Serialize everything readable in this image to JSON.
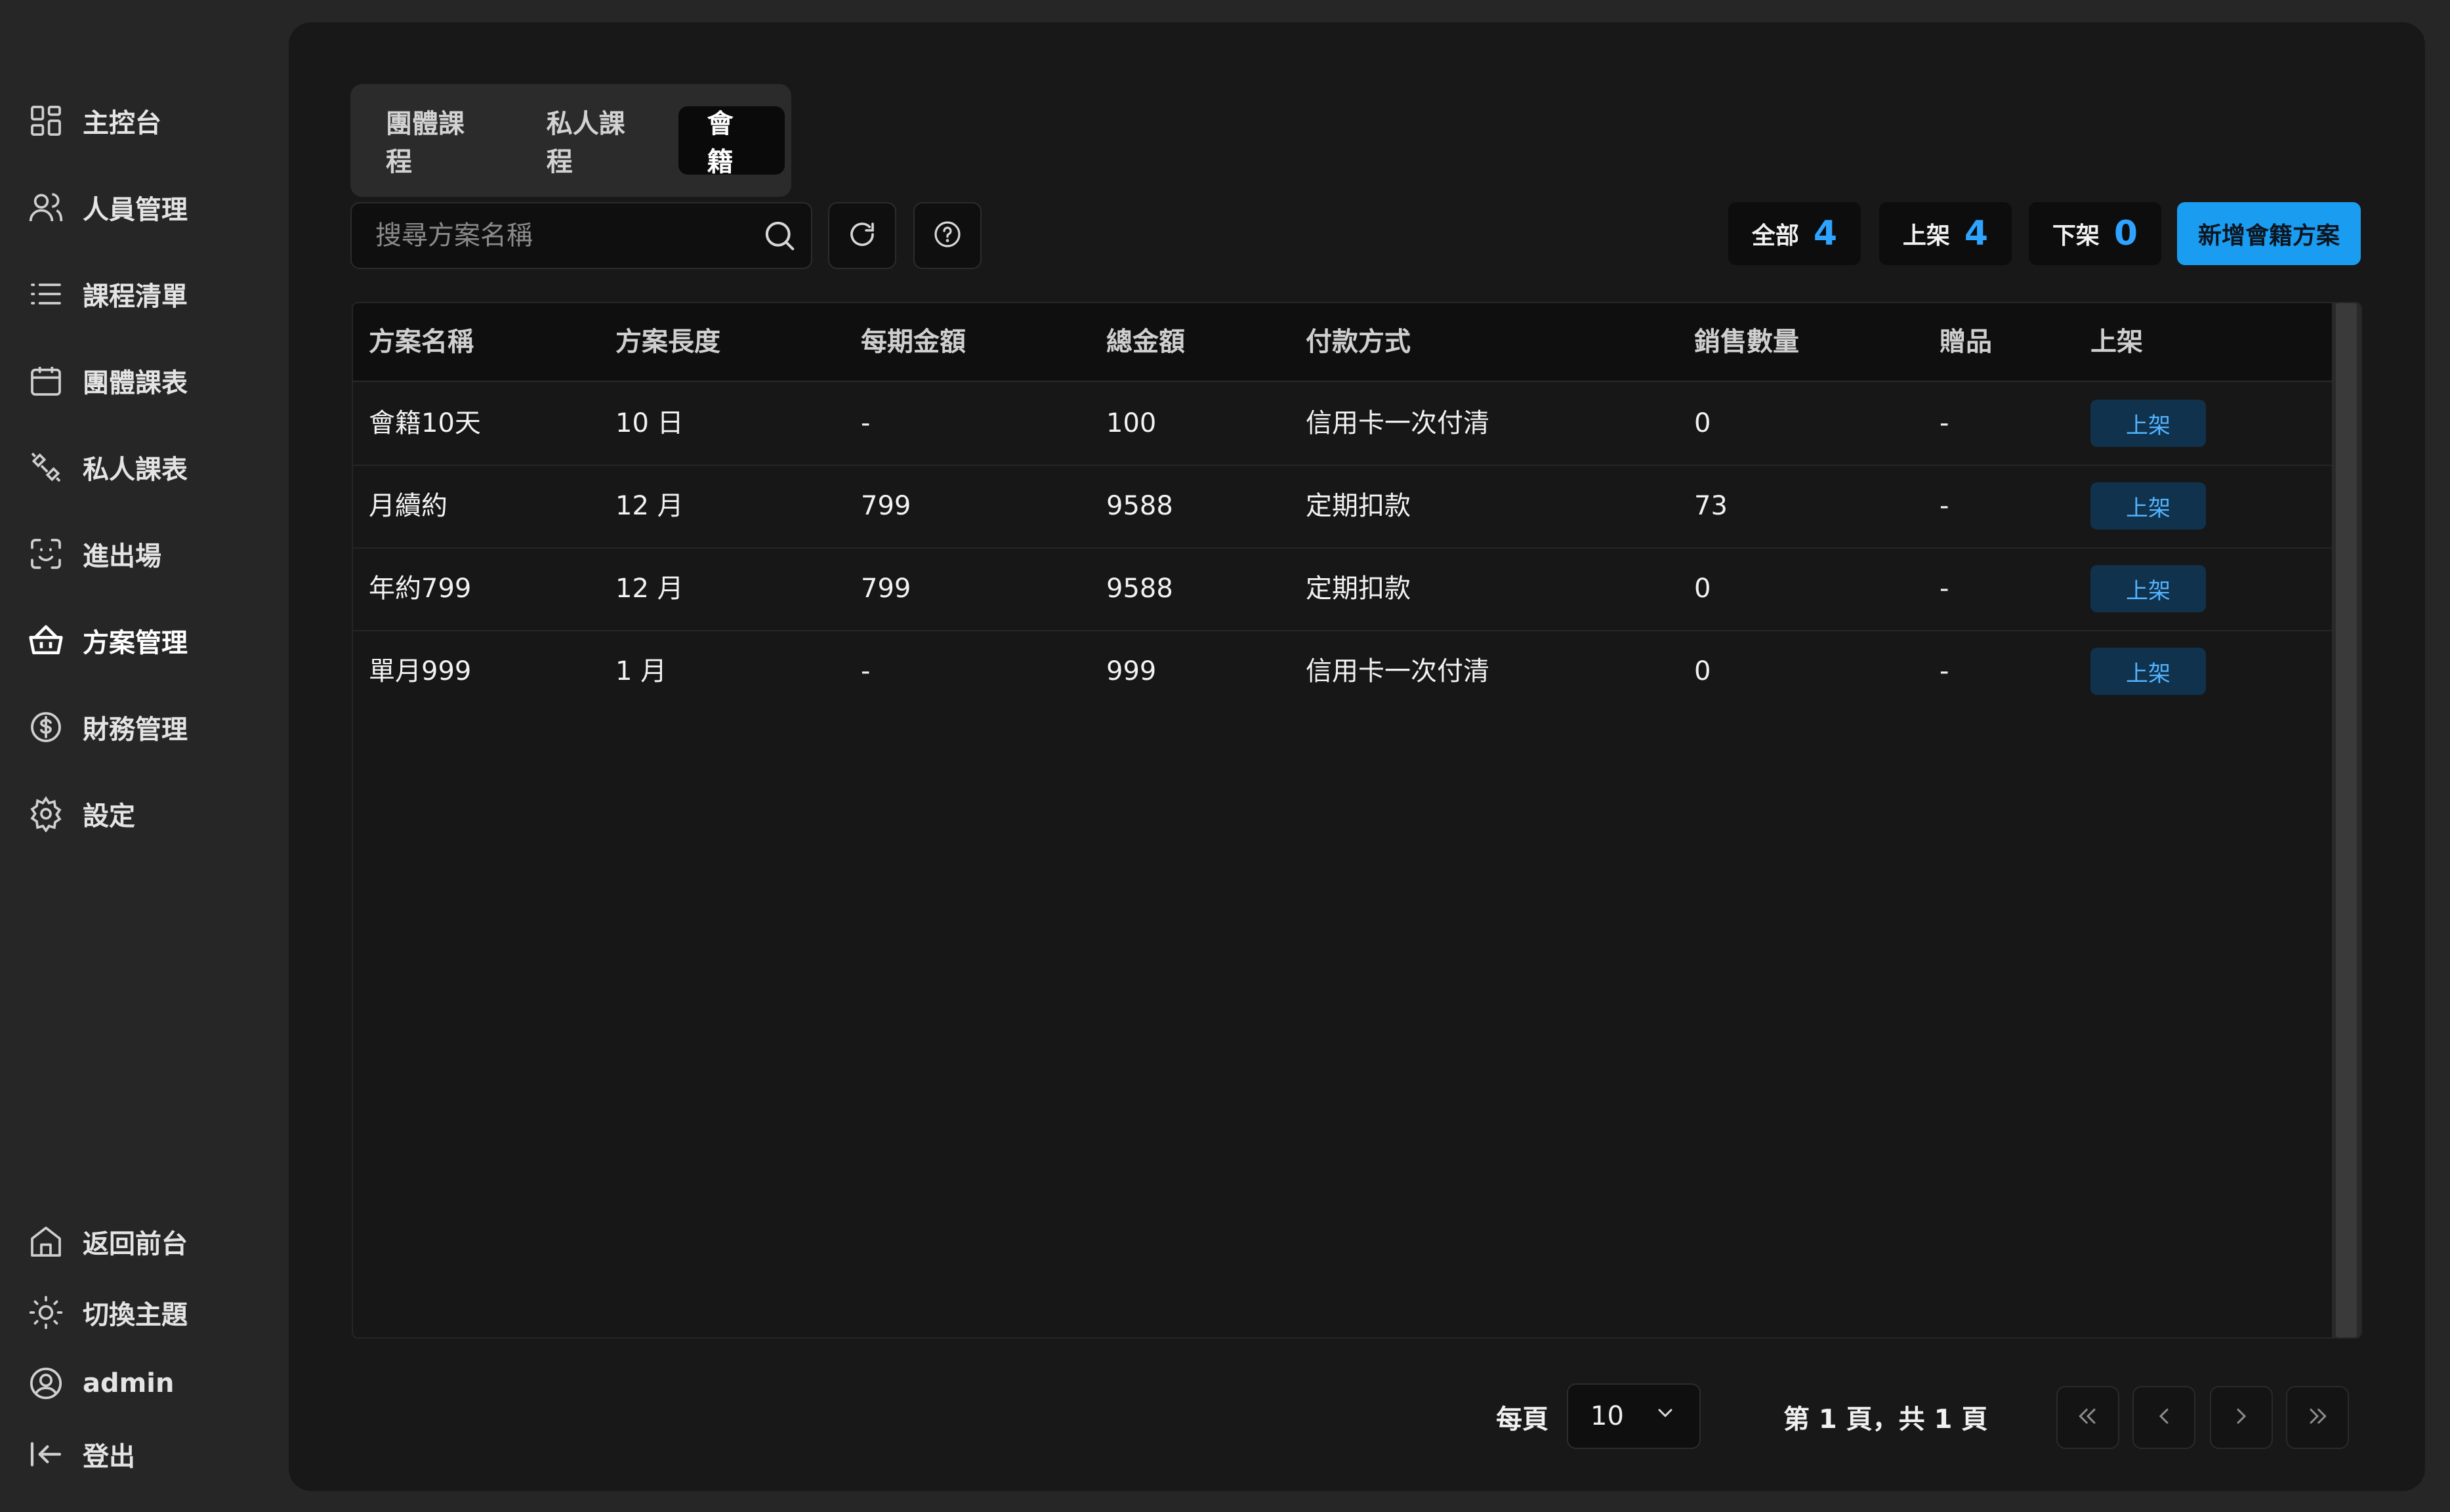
{
  "sidebar": {
    "items": [
      {
        "label": "主控台",
        "icon": "dashboard-icon"
      },
      {
        "label": "人員管理",
        "icon": "users-icon"
      },
      {
        "label": "課程清單",
        "icon": "list-icon"
      },
      {
        "label": "團體課表",
        "icon": "calendar-icon"
      },
      {
        "label": "私人課表",
        "icon": "dumbbell-icon"
      },
      {
        "label": "進出場",
        "icon": "scan-face-icon"
      },
      {
        "label": "方案管理",
        "icon": "basket-icon",
        "active": true
      },
      {
        "label": "財務管理",
        "icon": "dollar-circle-icon"
      },
      {
        "label": "設定",
        "icon": "gear-icon"
      }
    ],
    "bottom": [
      {
        "label": "返回前台",
        "icon": "home-icon"
      },
      {
        "label": "切換主題",
        "icon": "sun-icon"
      },
      {
        "label": "admin",
        "icon": "user-circle-icon"
      },
      {
        "label": "登出",
        "icon": "logout-icon"
      }
    ]
  },
  "tabs": [
    {
      "label": "團體課程"
    },
    {
      "label": "私人課程"
    },
    {
      "label": "會籍",
      "active": true
    }
  ],
  "search": {
    "placeholder": "搜尋方案名稱",
    "value": ""
  },
  "stats": [
    {
      "label": "全部",
      "count": "4"
    },
    {
      "label": "上架",
      "count": "4"
    },
    {
      "label": "下架",
      "count": "0"
    }
  ],
  "add_button": "新增會籍方案",
  "table": {
    "columns": [
      "方案名稱",
      "方案長度",
      "每期金額",
      "總金額",
      "付款方式",
      "銷售數量",
      "贈品",
      "上架"
    ],
    "rows": [
      {
        "name": "會籍10天",
        "length": "10 日",
        "per_period": "-",
        "total": "100",
        "payment": "信用卡一次付清",
        "sales": "0",
        "gift": "-",
        "status": "上架"
      },
      {
        "name": "月續約",
        "length": "12 月",
        "per_period": "799",
        "total": "9588",
        "payment": "定期扣款",
        "sales": "73",
        "gift": "-",
        "status": "上架"
      },
      {
        "name": "年約799",
        "length": "12 月",
        "per_period": "799",
        "total": "9588",
        "payment": "定期扣款",
        "sales": "0",
        "gift": "-",
        "status": "上架"
      },
      {
        "name": "單月999",
        "length": "1 月",
        "per_period": "-",
        "total": "999",
        "payment": "信用卡一次付清",
        "sales": "0",
        "gift": "-",
        "status": "上架"
      }
    ]
  },
  "pagination": {
    "per_page_label": "每頁",
    "per_page_value": "10",
    "page_info": "第 1 頁，共 1 頁"
  },
  "colors": {
    "accent": "#1a9cf0",
    "badge_bg": "#10324d",
    "badge_text": "#52b4ff",
    "panel": "#181818",
    "background": "#262626"
  }
}
